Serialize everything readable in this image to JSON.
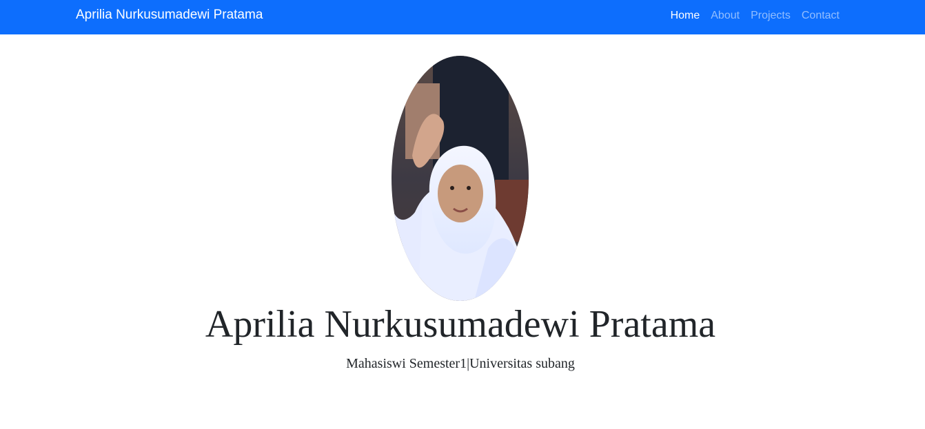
{
  "navbar": {
    "brand": "Aprilia Nurkusumadewi Pratama",
    "links": [
      {
        "label": "Home",
        "active": true
      },
      {
        "label": "About",
        "active": false
      },
      {
        "label": "Projects",
        "active": false
      },
      {
        "label": "Contact",
        "active": false
      }
    ],
    "background_color": "#0d6efd"
  },
  "hero": {
    "photo_alt": "profile-photo",
    "title": "Aprilia Nurkusumadewi Pratama",
    "subtitle": "Mahasiswi Semester1|Universitas subang"
  }
}
